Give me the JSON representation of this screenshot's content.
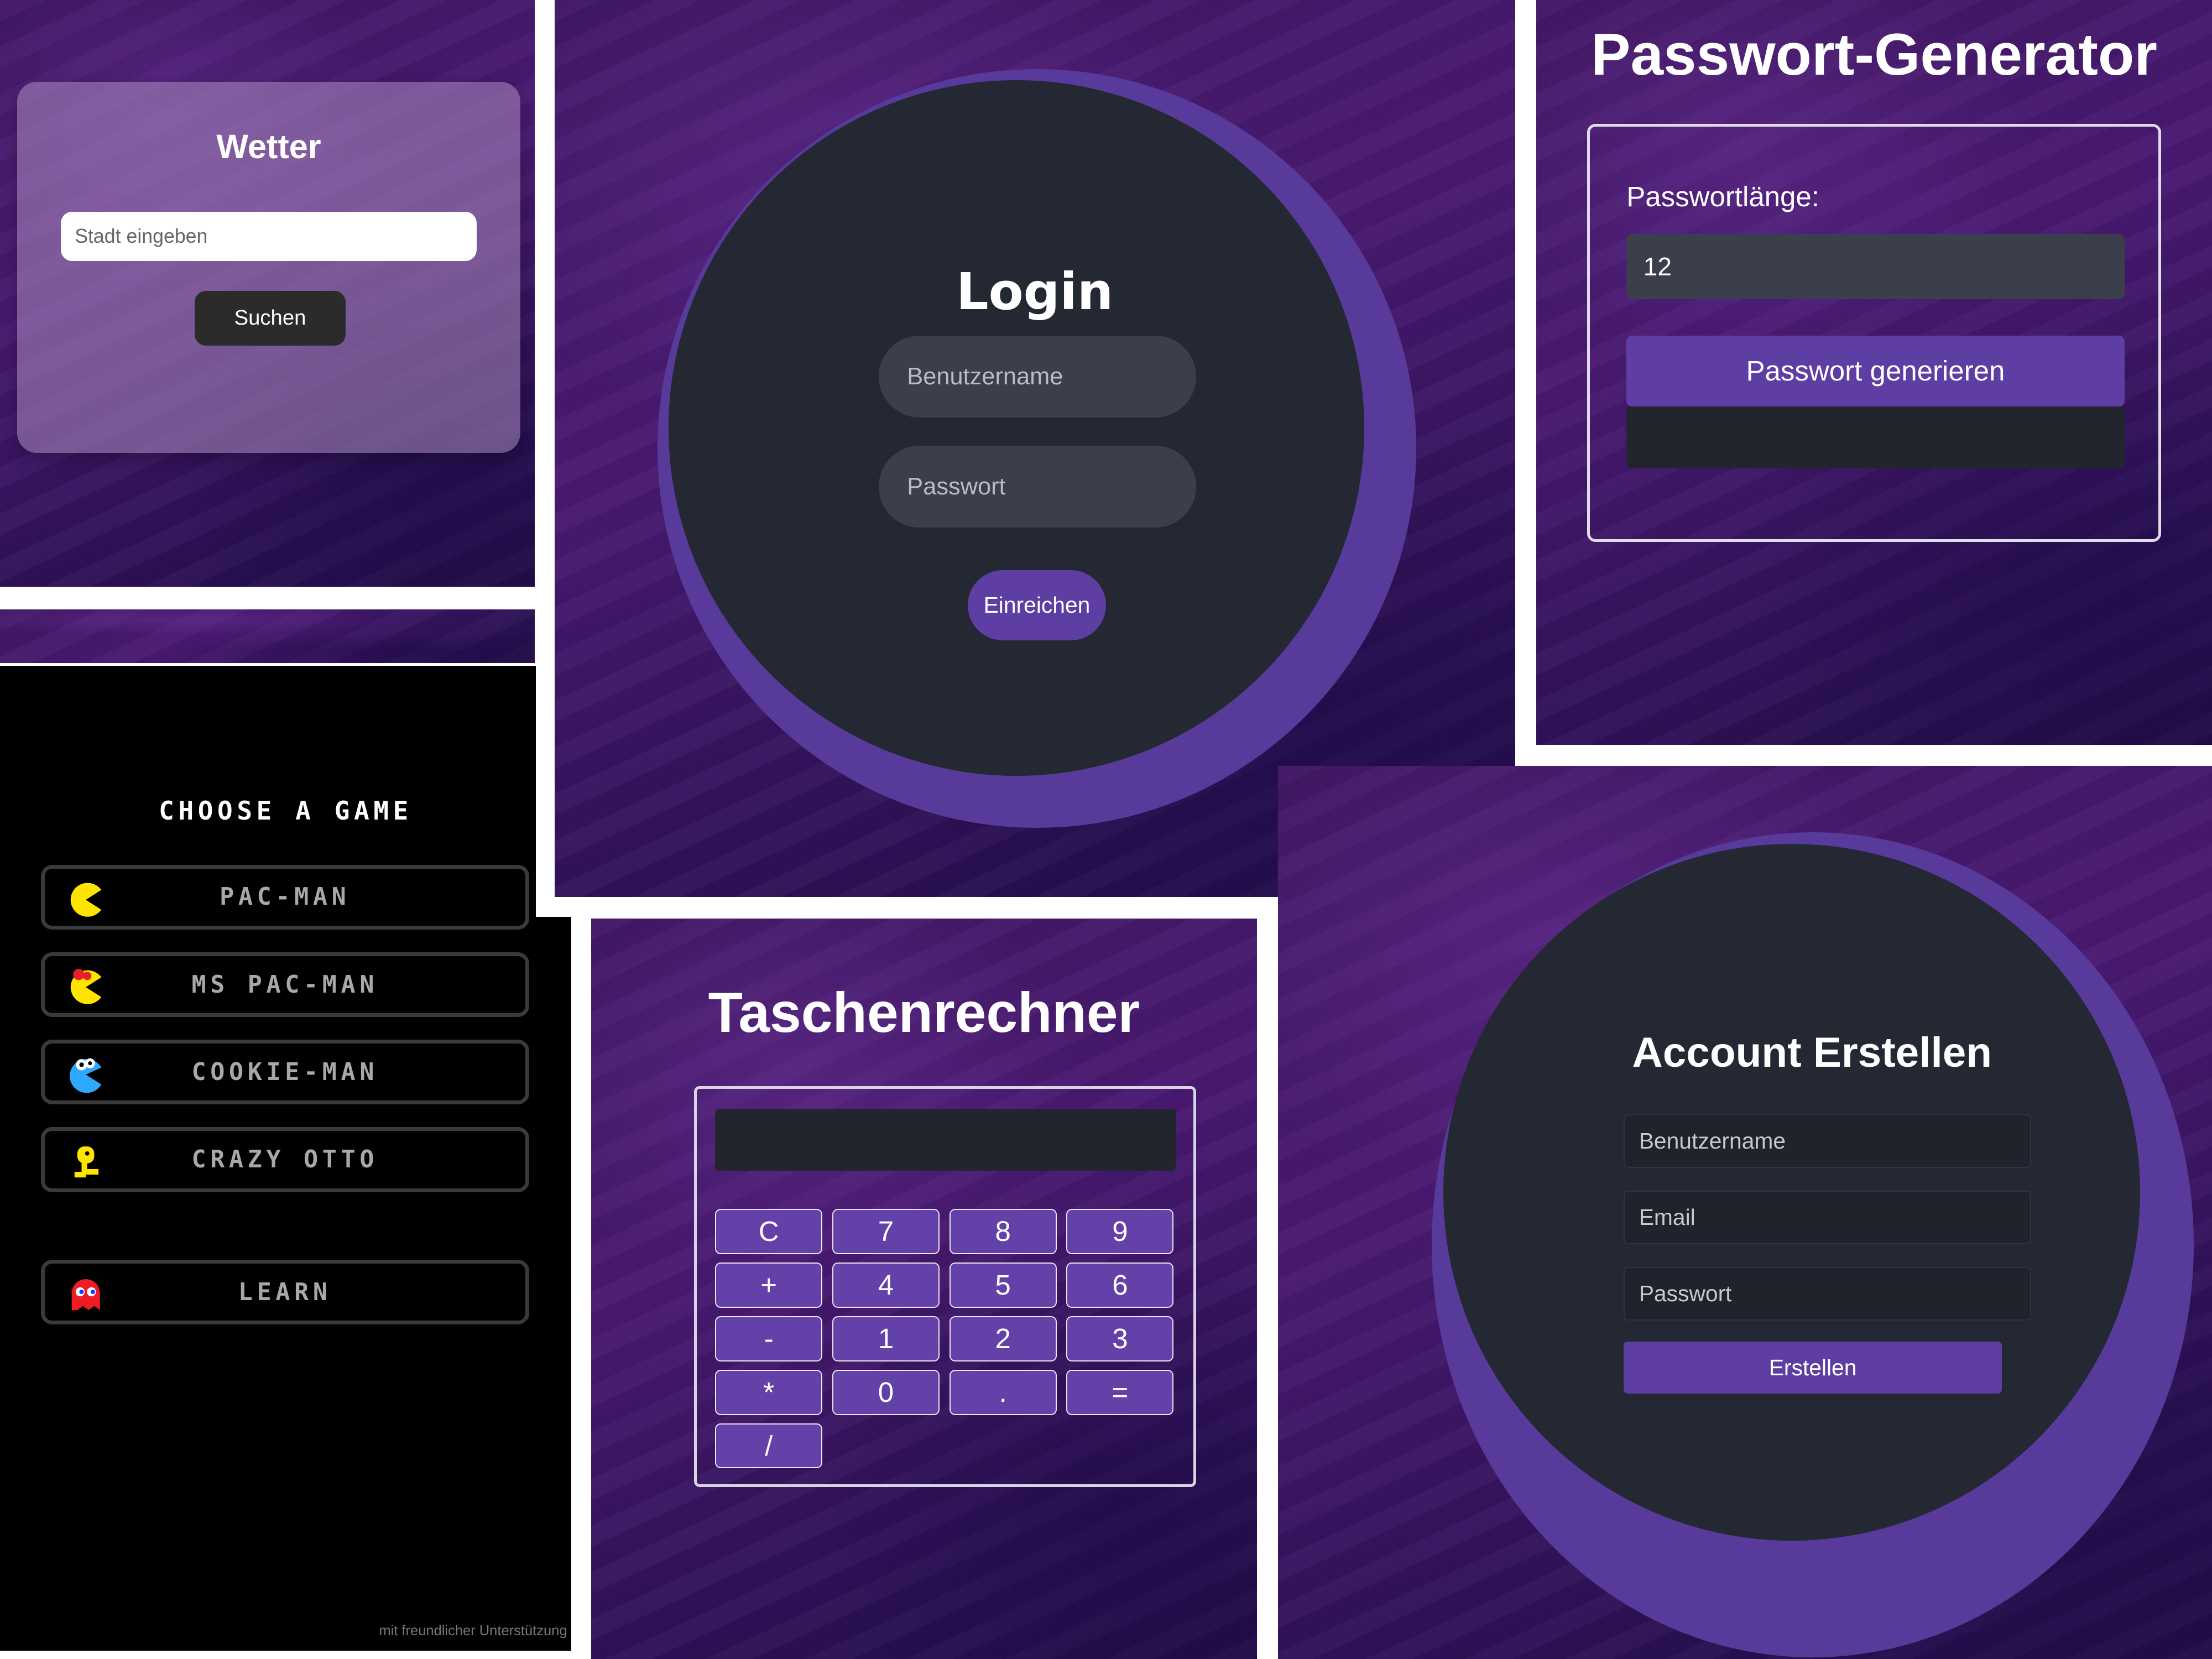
{
  "weather": {
    "title": "Wetter",
    "city_placeholder": "Stadt eingeben",
    "search_label": "Suchen"
  },
  "game_menu": {
    "title": "CHOOSE A GAME",
    "items": [
      {
        "label": "PAC-MAN",
        "icon": "pac-man-icon"
      },
      {
        "label": "MS PAC-MAN",
        "icon": "ms-pac-man-icon"
      },
      {
        "label": "COOKIE-MAN",
        "icon": "cookie-man-icon"
      },
      {
        "label": "CRAZY OTTO",
        "icon": "crazy-otto-icon"
      },
      {
        "label": "LEARN",
        "icon": "ghost-icon"
      }
    ],
    "footer": "mit freundlicher Unterstützung"
  },
  "login": {
    "title": "Login",
    "username_placeholder": "Benutzername",
    "password_placeholder": "Passwort",
    "submit_label": "Einreichen"
  },
  "password_generator": {
    "title": "Passwort-Generator",
    "length_label": "Passwortlänge:",
    "length_value": "12",
    "generate_label": "Passwort generieren"
  },
  "calculator": {
    "title": "Taschenrechner",
    "keys": [
      "C",
      "7",
      "8",
      "9",
      "+",
      "4",
      "5",
      "6",
      "-",
      "1",
      "2",
      "3",
      "*",
      "0",
      ".",
      "=",
      "/"
    ]
  },
  "register": {
    "title": "Account Erstellen",
    "username_placeholder": "Benutzername",
    "email_placeholder": "Email",
    "password_placeholder": "Passwort",
    "create_label": "Erstellen"
  },
  "colors": {
    "accent": "#5e3ea3",
    "card_dark": "#232833",
    "ring": "#583a9a",
    "background": "#3f1763"
  }
}
